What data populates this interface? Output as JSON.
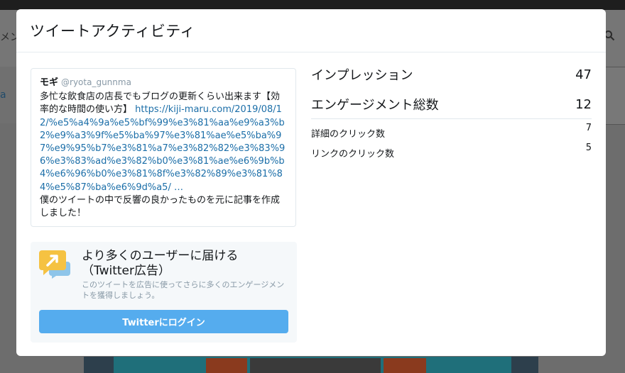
{
  "background": {
    "left_edge_text_1": "メン",
    "left_edge_text_2": "a"
  },
  "modal": {
    "title": "ツイートアクティビティ"
  },
  "tweet": {
    "name": "モギ",
    "handle": "@ryota_gunnma",
    "text_before_link": "多忙な飲食店の店長でもブログの更新くらい出来ます【効率的な時間の使い方】 ",
    "link": "https://kiji-maru.com/2019/08/12/%e5%a4%9a%e5%bf%99%e3%81%aa%e9%a3%b2%e9%a3%9f%e5%ba%97%e3%81%ae%e5%ba%97%e9%95%b7%e3%81%a7%e3%82%82%e3%83%96%e3%83%ad%e3%82%b0%e3%81%ae%e6%9b%b4%e6%96%b0%e3%81%8f%e3%82%89%e3%81%84%e5%87%ba%e6%9d%a5/ …",
    "text_after_link": "僕のツイートの中で反響の良かったものを元に記事を作成しました！"
  },
  "promo": {
    "title": "より多くのユーザーに届ける（Twitter広告）",
    "description": "このツイートを広告に使ってさらに多くのエンゲージメントを獲得しましょう。",
    "button_label": "Twitterにログイン",
    "icon": "promote-arrow-icon",
    "icon_colors": {
      "primary": "#f5c242",
      "secondary": "#8ec5e9"
    }
  },
  "stats": {
    "impressions": {
      "label": "インプレッション",
      "value": "47"
    },
    "engagements": {
      "label": "エンゲージメント総数",
      "value": "12"
    },
    "details": [
      {
        "label": "詳細のクリック数",
        "value": "7"
      },
      {
        "label": "リンクのクリック数",
        "value": "5"
      }
    ]
  },
  "colors": {
    "link": "#1b6ea8",
    "button": "#55acee",
    "muted": "#8899a6"
  }
}
